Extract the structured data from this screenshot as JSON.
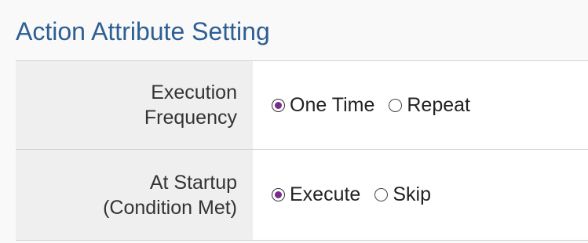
{
  "section": {
    "title": "Action Attribute Setting"
  },
  "rows": [
    {
      "label": "Execution\nFrequency",
      "options": [
        {
          "label": "One Time",
          "selected": true
        },
        {
          "label": "Repeat",
          "selected": false
        }
      ]
    },
    {
      "label": "At Startup\n(Condition Met)",
      "options": [
        {
          "label": "Execute",
          "selected": true
        },
        {
          "label": "Skip",
          "selected": false
        }
      ]
    }
  ],
  "colors": {
    "title": "#2e5f92",
    "radio_selected": "#7b2a8e",
    "label_background": "#efefef"
  }
}
